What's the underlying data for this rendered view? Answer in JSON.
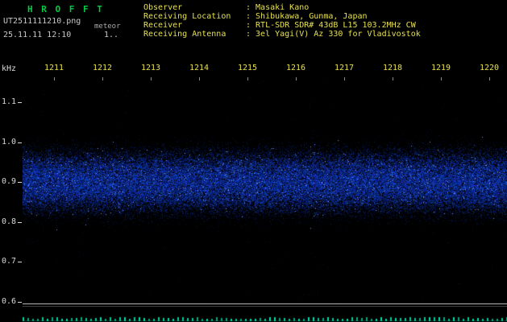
{
  "colors": {
    "background": "#000000",
    "title_green": "#00cc44",
    "header_yellow": "#e6e050",
    "text_gray": "#c8c8c8",
    "axis_white": "#d8d8d8",
    "tick_yellow": "#e6e050",
    "separator_gray": "#b8b8b8",
    "baseline_cyan": "#00c896",
    "noise_blue_bright": "#7f9fff",
    "noise_blue_mid": "#2244cc",
    "noise_blue_dark": "#0a1a66"
  },
  "header": {
    "app_title": "H R O F F T",
    "filename": "UT2511111210.png",
    "tag": "meteor",
    "datetime": "25.11.11 12:10",
    "extra": "1..",
    "info_rows": [
      {
        "label": "Observer",
        "value": ": Masaki Kano"
      },
      {
        "label": "Receiving Location",
        "value": ": Shibukawa, Gunma, Japan"
      },
      {
        "label": "Receiver",
        "value": ": RTL-SDR SDR# 43dB L15 103.2MHz CW"
      },
      {
        "label": "Receiving Antenna",
        "value": ": 3el Yagi(V) Az 330 for Vladivostok"
      }
    ]
  },
  "chart_data": {
    "type": "heatmap",
    "subtype": "radio-meteor-spectrogram",
    "title": "",
    "grid": false,
    "x_axis": {
      "unit": "hhmm (UT)",
      "tick_labels": [
        "1211",
        "1212",
        "1213",
        "1214",
        "1215",
        "1216",
        "1217",
        "1218",
        "1219",
        "1220"
      ]
    },
    "y_axis": {
      "label": "kHz",
      "tick_labels": [
        "1.1",
        "1.0",
        "0.9",
        "0.8",
        "0.7",
        "0.6"
      ],
      "range_khz": [
        0.55,
        1.15
      ]
    },
    "noise_band": {
      "center_khz": 0.9,
      "extent_khz": [
        0.8,
        1.0
      ],
      "appearance": "continuous speckled blue noise band spanning full width, no meteor echo spikes"
    },
    "bottom_level_graph": {
      "appearance": "flat baseline of short cyan ticks along bottom edge, no activity peaks"
    }
  }
}
